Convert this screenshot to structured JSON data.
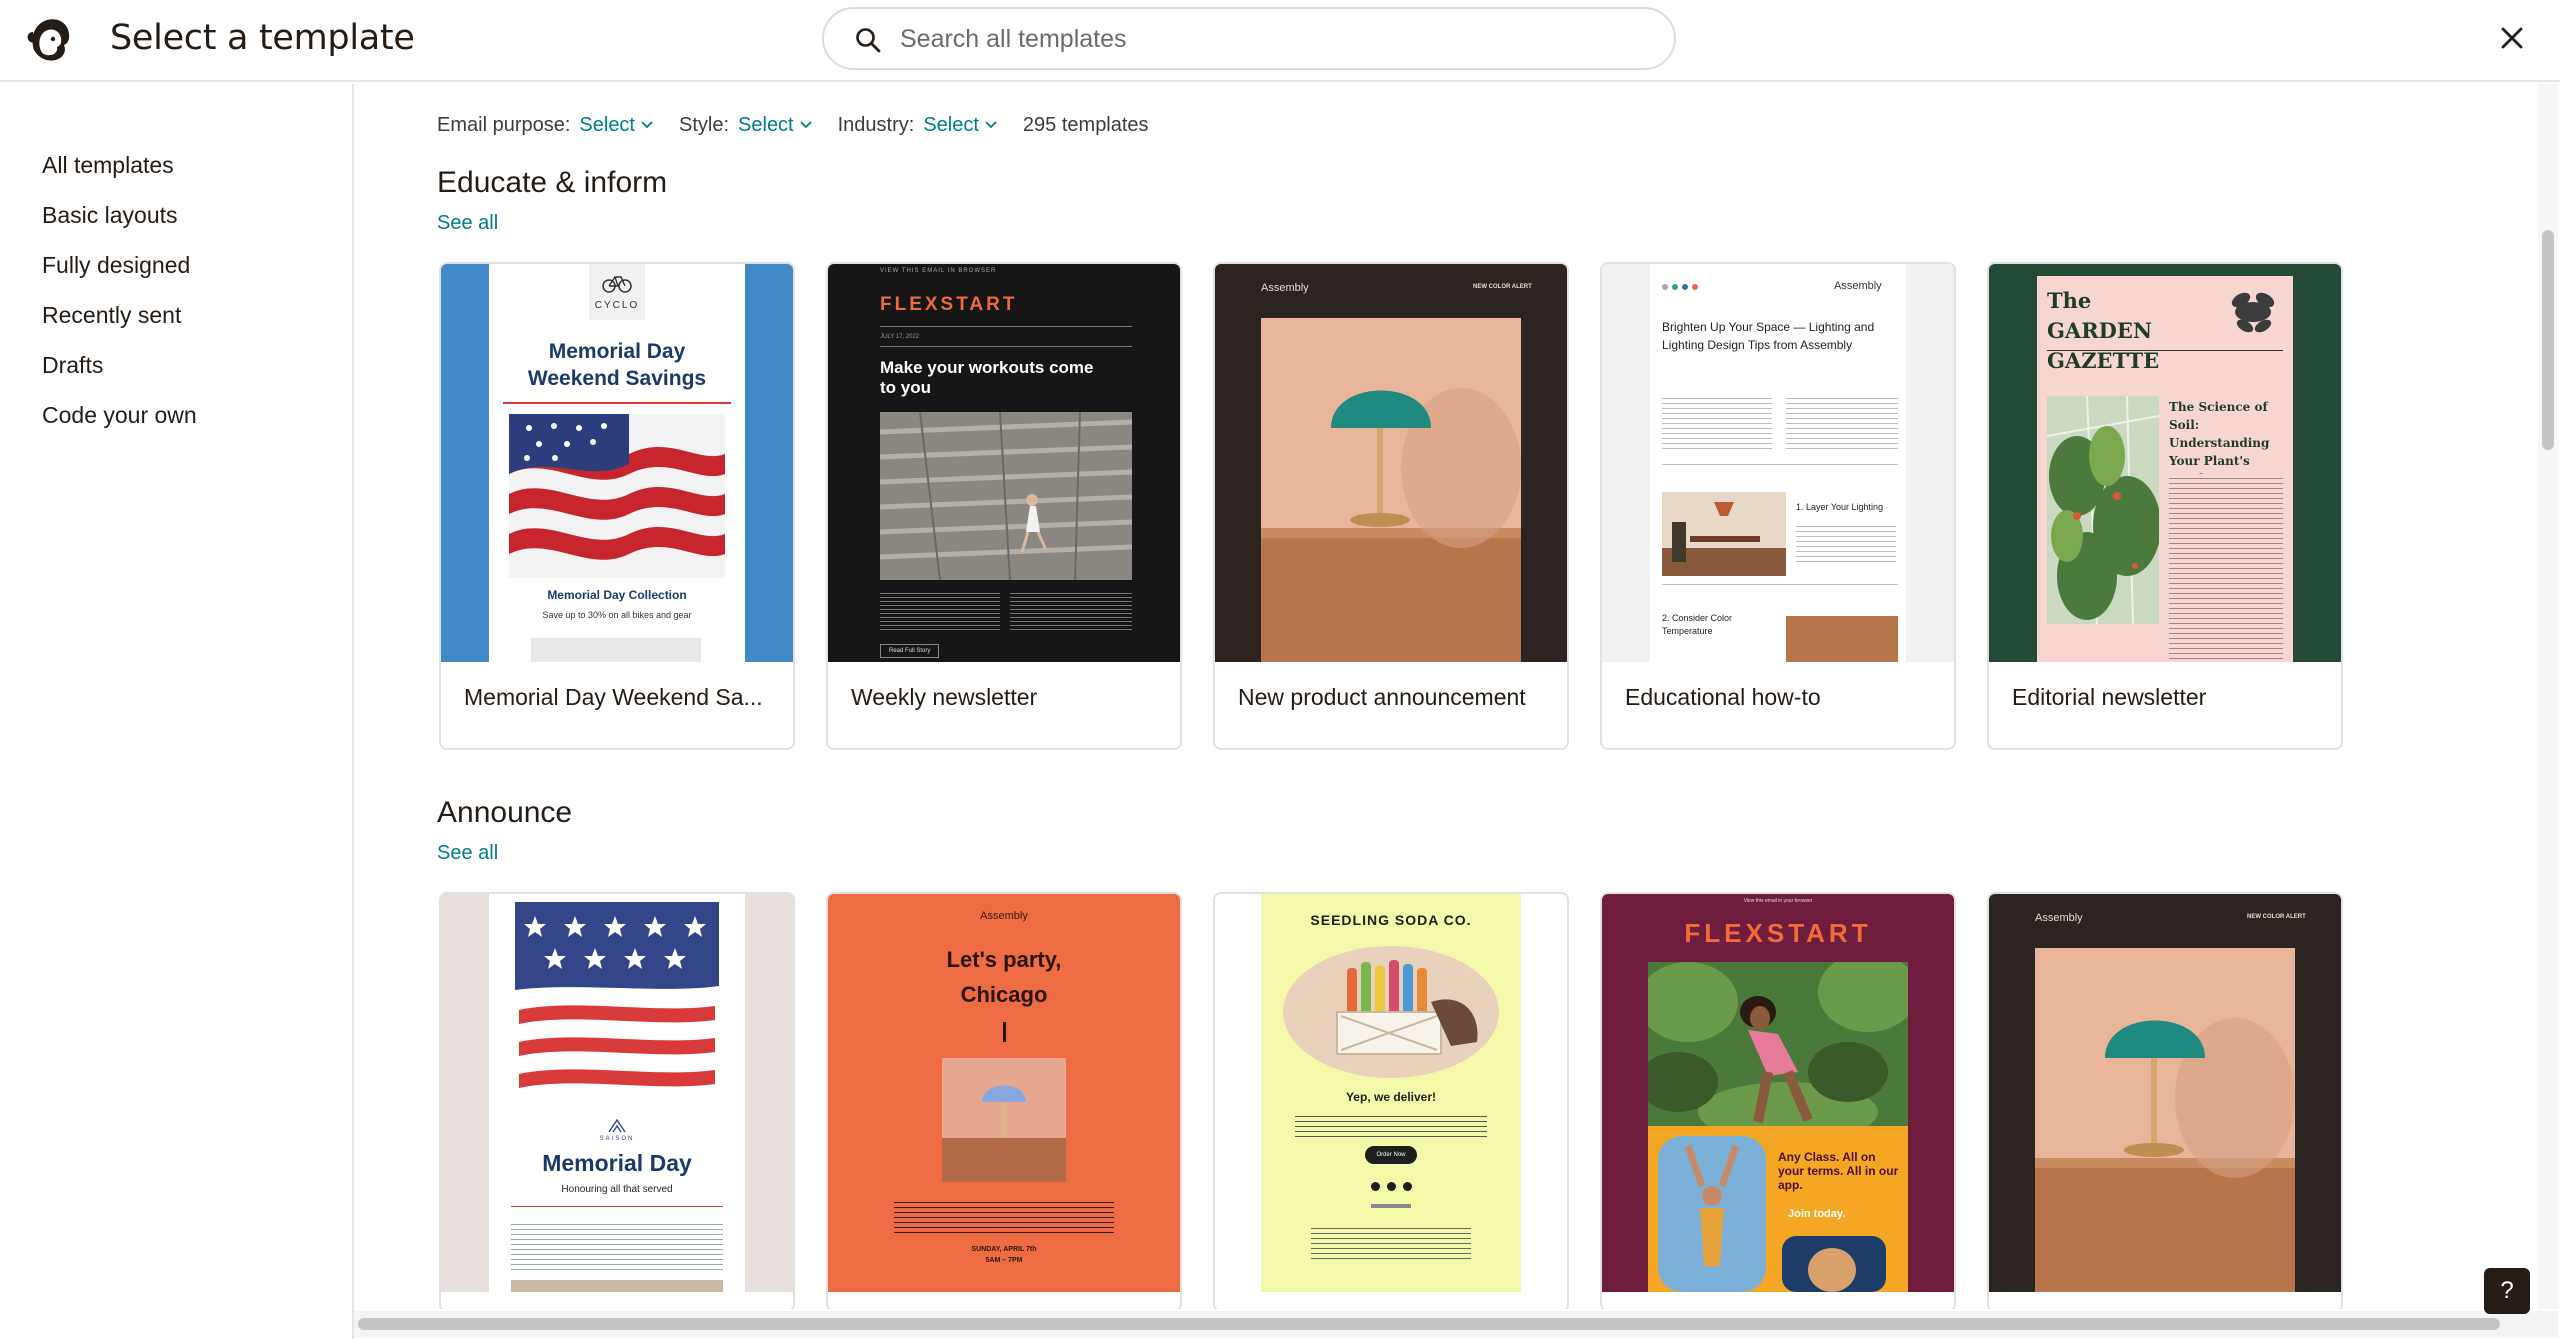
{
  "header": {
    "title": "Select a template",
    "search_placeholder": "Search all templates"
  },
  "sidebar": {
    "items": [
      {
        "label": "All templates"
      },
      {
        "label": "Basic layouts"
      },
      {
        "label": "Fully designed"
      },
      {
        "label": "Recently sent"
      },
      {
        "label": "Drafts"
      },
      {
        "label": "Code your own"
      }
    ]
  },
  "filters": {
    "email_purpose_label": "Email purpose:",
    "email_purpose_value": "Select",
    "style_label": "Style:",
    "style_value": "Select",
    "industry_label": "Industry:",
    "industry_value": "Select",
    "count": "295 templates"
  },
  "sections": [
    {
      "title": "Educate & inform",
      "see_all": "See all",
      "cards": [
        {
          "label": "Memorial Day Weekend Sa...",
          "brand": "CYCLO",
          "heading": "Memorial Day Weekend Savings",
          "sub": "Memorial Day Collection",
          "note": "Save up to 30% on all bikes and gear"
        },
        {
          "label": "Weekly newsletter",
          "brand": "FLEXSTART",
          "heading": "Make your workouts come to you",
          "button": "Read Full Story",
          "top_link": "VIEW THIS EMAIL IN BROWSER",
          "date": "JULY 17, 2022"
        },
        {
          "label": "New product announcement",
          "brand": "Assembly",
          "tag": "NEW COLOR ALERT"
        },
        {
          "label": "Educational how-to",
          "brand": "Assembly",
          "heading": "Brighten Up Your Space — Lighting and Lighting Design Tips from Assembly",
          "step1": "1. Layer Your Lighting",
          "step2": "2. Consider Color Temperature"
        },
        {
          "label": "Editorial newsletter",
          "brand": "The GARDEN GAZETTE",
          "heading": "The Science of Soil: Understanding Your Plant's Needs"
        }
      ]
    },
    {
      "title": "Announce",
      "see_all": "See all",
      "cards": [
        {
          "brand": "SAISON",
          "heading": "Memorial Day",
          "sub": "Honouring all that served"
        },
        {
          "brand": "Assembly",
          "heading": "Let's party, Chicago",
          "date": "SUNDAY, APRIL 7th",
          "time": "5AM – 7PM"
        },
        {
          "brand": "SEEDLING SODA CO.",
          "heading": "Yep, we deliver!",
          "button": "Order Now"
        },
        {
          "brand": "FLEXSTART",
          "top_link": "View this email in your browser",
          "heading": "Any Class. All on your terms. All in our app.",
          "cta": "Join today."
        },
        {
          "brand": "Assembly",
          "tag": "NEW COLOR ALERT"
        }
      ]
    }
  ],
  "help": "?"
}
